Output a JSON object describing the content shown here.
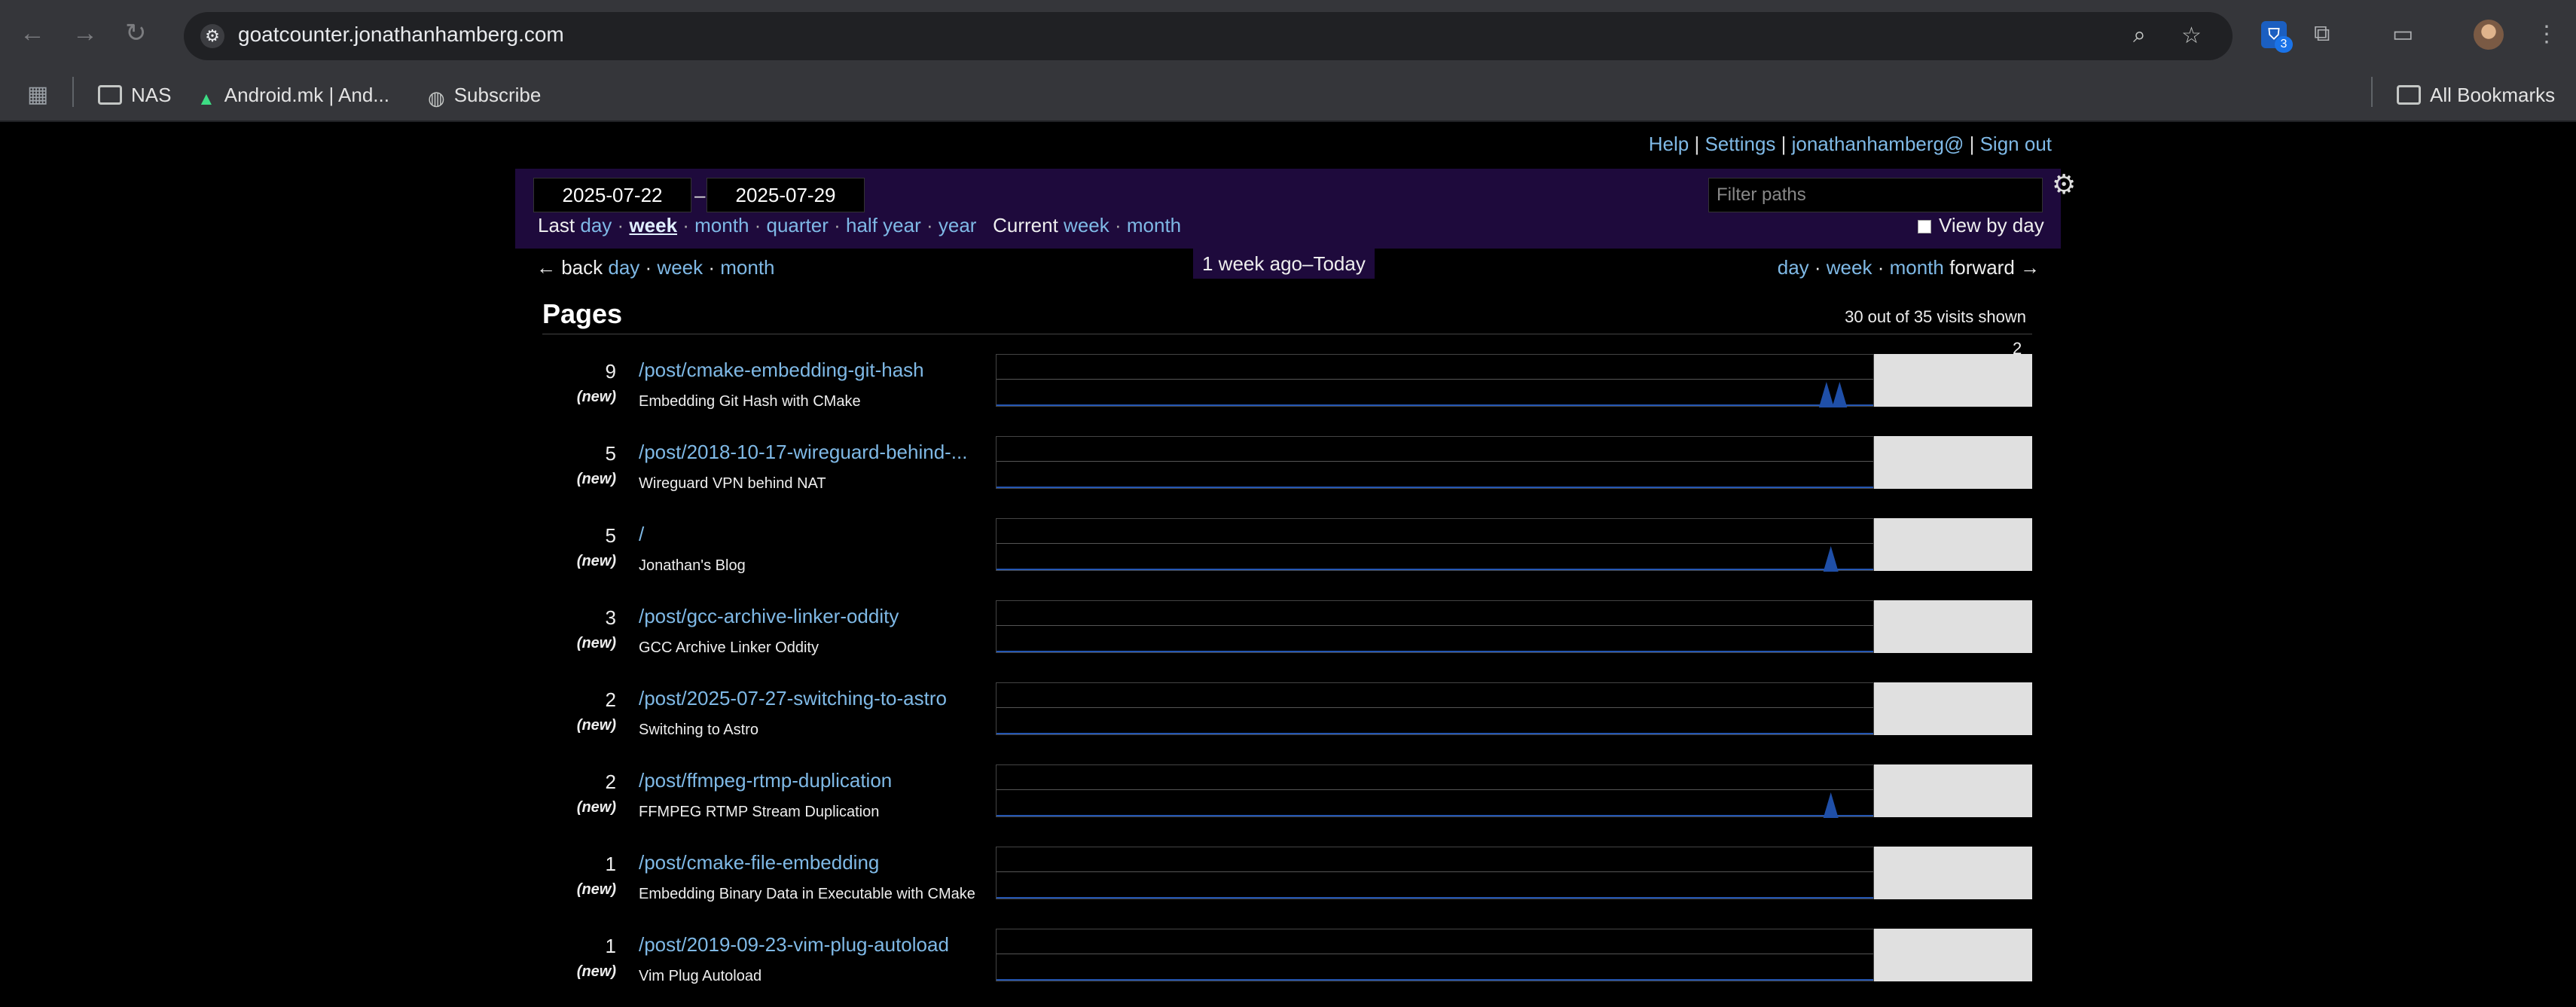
{
  "browser": {
    "url": "goatcounter.jonathanhamberg.com",
    "extension_count": "3",
    "bookmarks": [
      {
        "label": "NAS",
        "icon": "folder-icon"
      },
      {
        "label": "Android.mk  |  And...",
        "icon": "android-icon"
      },
      {
        "label": "Subscribe",
        "icon": "globe-icon"
      }
    ],
    "all_bookmarks": "All Bookmarks"
  },
  "header": {
    "help": "Help",
    "settings": "Settings",
    "user": "jonathanhamberg@",
    "sign_out": "Sign out"
  },
  "filters": {
    "start_date": "2025-07-22",
    "end_date": "2025-07-29",
    "last_label": "Last",
    "last_options": [
      "day",
      "week",
      "month",
      "quarter",
      "half year",
      "year"
    ],
    "selected": "week",
    "current_label": "Current",
    "current_options": [
      "week",
      "month"
    ],
    "filter_placeholder": "Filter paths",
    "view_by_day": "View by day"
  },
  "navigation": {
    "back": "← back",
    "back_options": [
      "day",
      "week",
      "month"
    ],
    "range": "1 week ago–Today",
    "forward": "forward →",
    "forward_options": [
      "day",
      "week",
      "month"
    ]
  },
  "pages": {
    "title": "Pages",
    "shown": "30 out of 35 visits shown",
    "max": "2",
    "new_label": "(new)",
    "rows": [
      {
        "count": "9",
        "path": "/post/cmake-embedding-git-hash",
        "title": "Embedding Git Hash with CMake",
        "spikes": [
          0.945,
          0.96
        ]
      },
      {
        "count": "5",
        "path": "/post/2018-10-17-wireguard-behind-...",
        "title": "Wireguard VPN behind NAT",
        "spikes": []
      },
      {
        "count": "5",
        "path": "/",
        "title": "Jonathan's Blog",
        "spikes": [
          0.95
        ]
      },
      {
        "count": "3",
        "path": "/post/gcc-archive-linker-oddity",
        "title": "GCC Archive Linker Oddity",
        "spikes": []
      },
      {
        "count": "2",
        "path": "/post/2025-07-27-switching-to-astro",
        "title": "Switching to Astro",
        "spikes": []
      },
      {
        "count": "2",
        "path": "/post/ffmpeg-rtmp-duplication",
        "title": "FFMPEG RTMP Stream Duplication",
        "spikes": [
          0.95
        ]
      },
      {
        "count": "1",
        "path": "/post/cmake-file-embedding",
        "title": "Embedding Binary Data in Executable with CMake",
        "spikes": []
      },
      {
        "count": "1",
        "path": "/post/2019-09-23-vim-plug-autoload",
        "title": "Vim Plug Autoload",
        "spikes": []
      }
    ]
  }
}
